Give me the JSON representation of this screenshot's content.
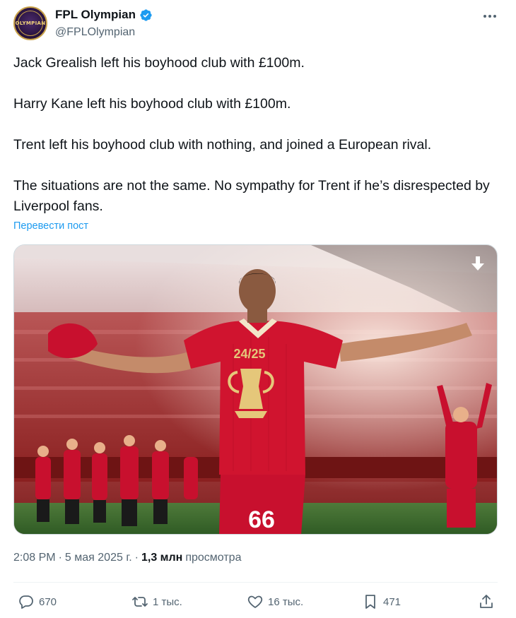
{
  "author": {
    "display_name": "FPL Olympian",
    "handle": "@FPLOlympian",
    "avatar_text": "OLYMPIAN"
  },
  "tweet": {
    "paragraphs": [
      "Jack Grealish left his boyhood club with £100m.",
      "Harry Kane left his boyhood club with £100m.",
      "Trent left his boyhood club with nothing, and joined a European rival.",
      "The situations are not the same. No sympathy for Trent if he’s disrespected by Liverpool fans."
    ],
    "translate_label": "Перевести пост",
    "photo_overlay_texts": {
      "number": "66",
      "shirt_text": "24/25"
    }
  },
  "meta": {
    "time": "2:08 PM",
    "separator": "·",
    "date": "5 мая 2025 г.",
    "views_count": "1,3 млн",
    "views_label": "просмотра"
  },
  "actions": {
    "replies": "670",
    "reposts": "1 тыс.",
    "likes": "16 тыс.",
    "bookmarks": "471"
  },
  "colors": {
    "accent": "#1d9bf0",
    "text": "#0f1419",
    "secondary": "#536471",
    "liverpool_red": "#c8102e"
  },
  "icons": {
    "verified": "verified-badge-icon",
    "more": "more-dots-icon",
    "download": "download-arrow-icon",
    "reply": "reply-bubble-icon",
    "repost": "repost-icon",
    "like": "heart-icon",
    "bookmark": "bookmark-icon",
    "share": "share-icon"
  }
}
